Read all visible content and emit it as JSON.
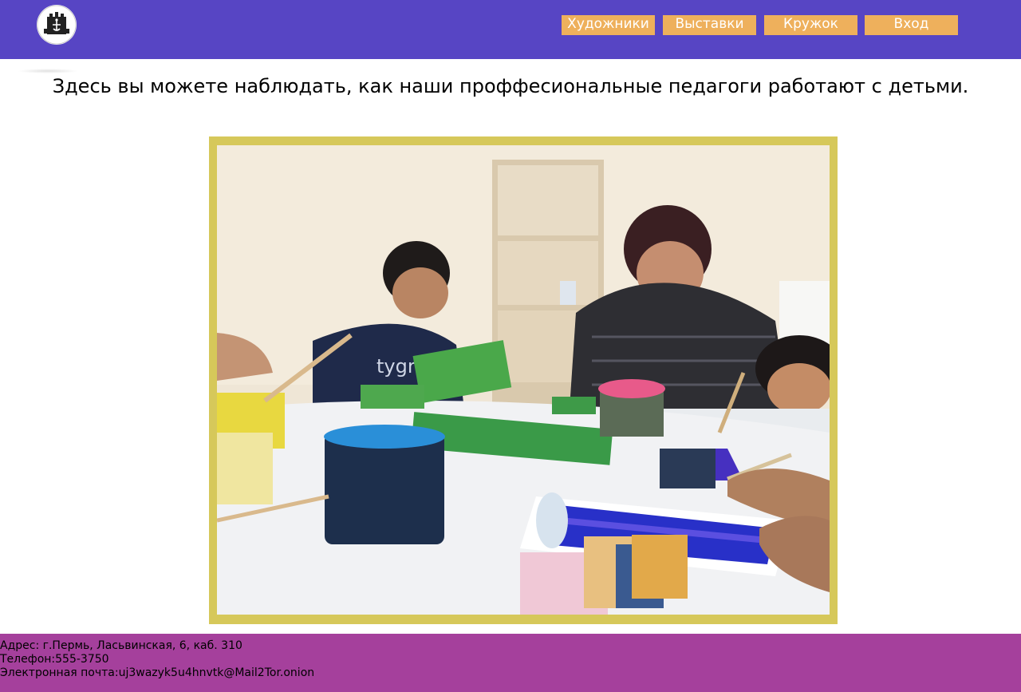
{
  "header": {
    "logo_icon": "anchor-ship-emblem-icon",
    "background_color": "#5745c4",
    "nav": [
      {
        "label": "Художники"
      },
      {
        "label": "Выставки"
      },
      {
        "label": "Кружок"
      },
      {
        "label": "Вход"
      }
    ],
    "nav_button_color": "#eeb05c"
  },
  "main": {
    "intro_text": "Здесь вы можете наблюдать, как наши проффесиональные педагоги работают с детьми.",
    "photo": {
      "alt": "",
      "frame_color": "#d6c85a"
    }
  },
  "footer": {
    "background_color": "#a5409c",
    "address": "Адрес: г.Пермь, Ласьвинская, 6, каб. 310",
    "phone": "Телефон:555-3750",
    "email": "Электронная почта:uj3wazyk5u4hnvtk@Mail2Tor.onion"
  }
}
